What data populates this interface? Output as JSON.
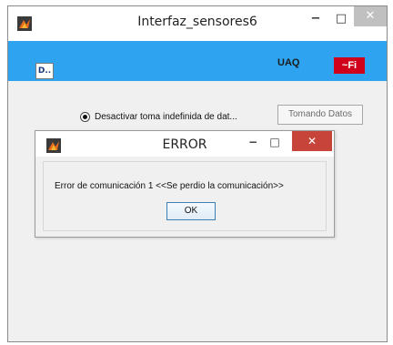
{
  "main_window": {
    "title": "Interfaz_sensores6",
    "controls": {
      "minimize": "−",
      "maximize": "□",
      "close": "✕"
    },
    "header": {
      "university_label": "UAQ",
      "logo_text": "~Fi",
      "colors": {
        "panel": "#2ea4f0",
        "logo": "#d0021b"
      }
    },
    "radio_label": "Desactivar toma indefinida de dat...",
    "radio_selected": true,
    "data_button_label": "Tomando Datos"
  },
  "dialog": {
    "title": "ERROR",
    "controls": {
      "minimize": "−",
      "maximize": "□",
      "close": "✕"
    },
    "message": "Error de comunicación 1 <<Se perdio la comunicación>>",
    "ok_label": "OK",
    "colors": {
      "close": "#c7443b"
    }
  }
}
